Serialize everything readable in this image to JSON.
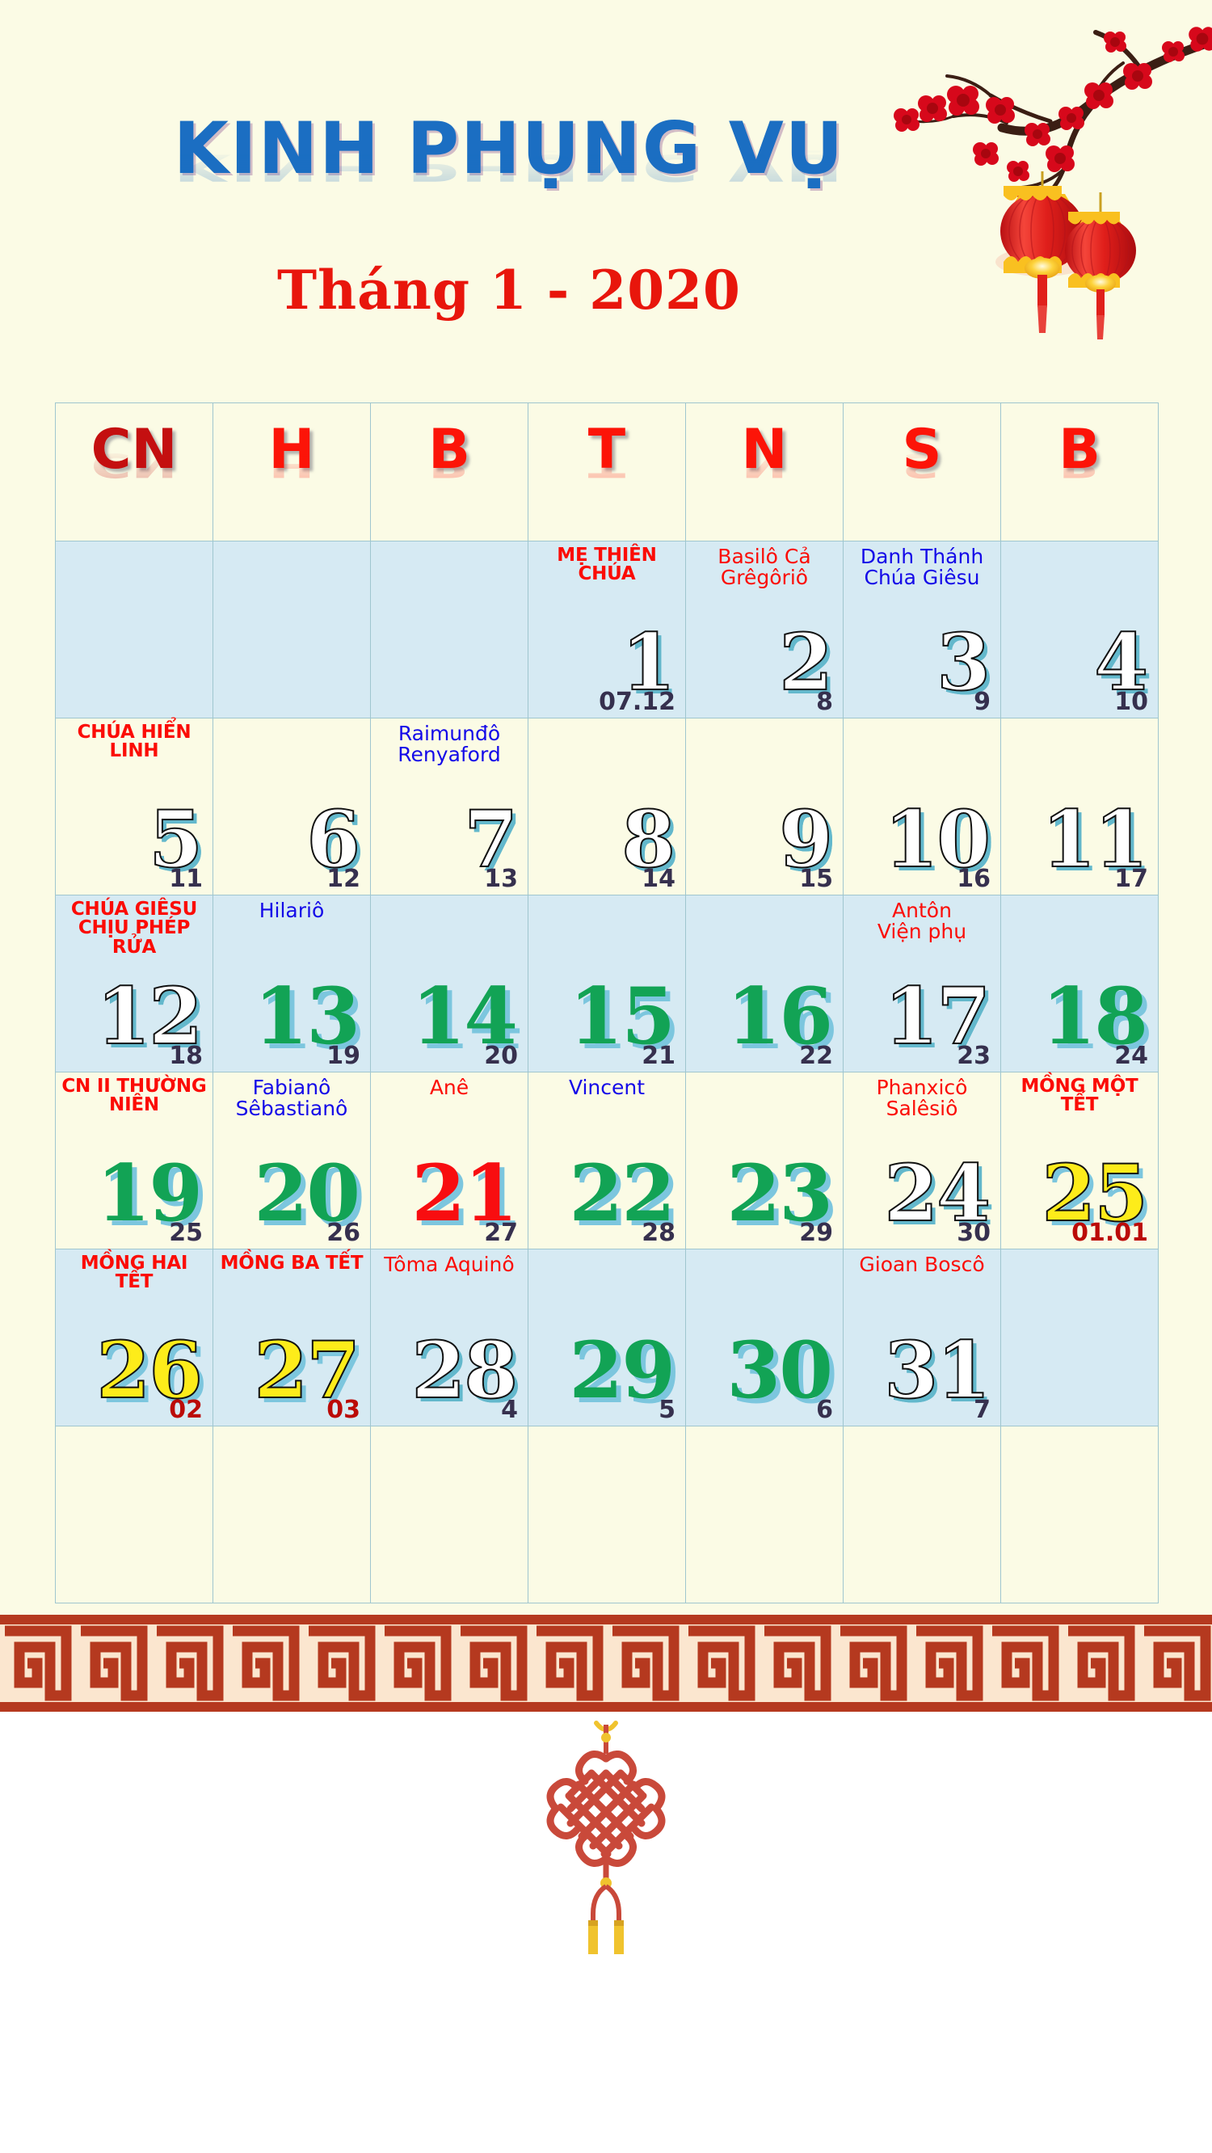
{
  "header": {
    "main_title": "KINH PHỤNG VỤ",
    "subtitle": "Tháng 1 - 2020",
    "title_color": "#1b6ec2",
    "subtitle_color": "#e8160c"
  },
  "decor": {
    "top_right": "plum-blossom-branch-and-lanterns-icon",
    "bottom": "chinese-knot-icon",
    "border_pattern": "greek-key-meander",
    "border_color": "#b5391f",
    "border_bg": "#fbe6cf",
    "lantern_color": "#e02019",
    "lantern_accent": "#f9c020",
    "blossom_color": "#d7081b",
    "branch_color": "#3b1e14",
    "knot_color": "#c9493a",
    "knot_tassel": "#f0c32e"
  },
  "weekdays": [
    {
      "label": "CN",
      "kind": "sun"
    },
    {
      "label": "H",
      "kind": "wk"
    },
    {
      "label": "B",
      "kind": "wk"
    },
    {
      "label": "T",
      "kind": "wk"
    },
    {
      "label": "N",
      "kind": "wk"
    },
    {
      "label": "S",
      "kind": "wk"
    },
    {
      "label": "B",
      "kind": "wk"
    }
  ],
  "colors": {
    "page_bg": "#fbfbe5",
    "row_blue": "#d6eaf3",
    "row_cream": "#fbfbe5",
    "grid_line": "#9fc6cf",
    "day_white": "#ffffff",
    "day_green": "#12a355",
    "day_red": "#f80d10",
    "day_yellow": "#fdec1a",
    "day_shadow": "#7cc6de",
    "lunar_text": "#36304e",
    "lunar_text_hl": "#bb0b08",
    "feast_red": "#fb0c06",
    "feast_blue": "#1409e8",
    "dow_sun": "#c40f10",
    "dow_week": "#fc1408"
  },
  "weeks": [
    {
      "bg": "blue",
      "days": [
        {
          "num": "",
          "feast": "",
          "feast_style": "",
          "lunar": "",
          "lunar_hl": false,
          "num_style": ""
        },
        {
          "num": "",
          "feast": "",
          "feast_style": "",
          "lunar": "",
          "lunar_hl": false,
          "num_style": ""
        },
        {
          "num": "",
          "feast": "",
          "feast_style": "",
          "lunar": "",
          "lunar_hl": false,
          "num_style": ""
        },
        {
          "num": "1",
          "feast": "MẸ THIÊN CHÚA",
          "feast_style": "solemn",
          "lunar": "07.12",
          "lunar_hl": false,
          "num_style": "white"
        },
        {
          "num": "2",
          "feast": "Basilô Cả\nGrêgôriô",
          "feast_style": "saint-red",
          "lunar": "8",
          "lunar_hl": false,
          "num_style": "white"
        },
        {
          "num": "3",
          "feast": "Danh Thánh\nChúa Giêsu",
          "feast_style": "saint-blue",
          "lunar": "9",
          "lunar_hl": false,
          "num_style": "white"
        },
        {
          "num": "4",
          "feast": "",
          "feast_style": "",
          "lunar": "10",
          "lunar_hl": false,
          "num_style": "white"
        }
      ]
    },
    {
      "bg": "cream",
      "days": [
        {
          "num": "5",
          "feast": "CHÚA HIỂN LINH",
          "feast_style": "solemn",
          "lunar": "11",
          "lunar_hl": false,
          "num_style": "white"
        },
        {
          "num": "6",
          "feast": "",
          "feast_style": "",
          "lunar": "12",
          "lunar_hl": false,
          "num_style": "white"
        },
        {
          "num": "7",
          "feast": "Raimunđô\nRenyaford",
          "feast_style": "saint-blue",
          "lunar": "13",
          "lunar_hl": false,
          "num_style": "white"
        },
        {
          "num": "8",
          "feast": "",
          "feast_style": "",
          "lunar": "14",
          "lunar_hl": false,
          "num_style": "white"
        },
        {
          "num": "9",
          "feast": "",
          "feast_style": "",
          "lunar": "15",
          "lunar_hl": false,
          "num_style": "white"
        },
        {
          "num": "10",
          "feast": "",
          "feast_style": "",
          "lunar": "16",
          "lunar_hl": false,
          "num_style": "white"
        },
        {
          "num": "11",
          "feast": "",
          "feast_style": "",
          "lunar": "17",
          "lunar_hl": false,
          "num_style": "white"
        }
      ]
    },
    {
      "bg": "blue",
      "days": [
        {
          "num": "12",
          "feast": "CHÚA GIÊSU\nCHỊU PHÉP RỬA",
          "feast_style": "solemn",
          "lunar": "18",
          "lunar_hl": false,
          "num_style": "white"
        },
        {
          "num": "13",
          "feast": "Hilariô",
          "feast_style": "saint-blue",
          "lunar": "19",
          "lunar_hl": false,
          "num_style": "green"
        },
        {
          "num": "14",
          "feast": "",
          "feast_style": "",
          "lunar": "20",
          "lunar_hl": false,
          "num_style": "green"
        },
        {
          "num": "15",
          "feast": "",
          "feast_style": "",
          "lunar": "21",
          "lunar_hl": false,
          "num_style": "green"
        },
        {
          "num": "16",
          "feast": "",
          "feast_style": "",
          "lunar": "22",
          "lunar_hl": false,
          "num_style": "green"
        },
        {
          "num": "17",
          "feast": "Antôn\nViện phụ",
          "feast_style": "saint-red",
          "lunar": "23",
          "lunar_hl": false,
          "num_style": "white"
        },
        {
          "num": "18",
          "feast": "",
          "feast_style": "",
          "lunar": "24",
          "lunar_hl": false,
          "num_style": "green"
        }
      ]
    },
    {
      "bg": "cream",
      "days": [
        {
          "num": "19",
          "feast": "CN II THƯỜNG NIÊN",
          "feast_style": "solemn",
          "lunar": "25",
          "lunar_hl": false,
          "num_style": "green"
        },
        {
          "num": "20",
          "feast": "Fabianô\nSêbastianô",
          "feast_style": "saint-blue",
          "lunar": "26",
          "lunar_hl": false,
          "num_style": "green"
        },
        {
          "num": "21",
          "feast": "Anê",
          "feast_style": "saint-red",
          "lunar": "27",
          "lunar_hl": false,
          "num_style": "red"
        },
        {
          "num": "22",
          "feast": "Vincent",
          "feast_style": "saint-blue",
          "lunar": "28",
          "lunar_hl": false,
          "num_style": "green"
        },
        {
          "num": "23",
          "feast": "",
          "feast_style": "",
          "lunar": "29",
          "lunar_hl": false,
          "num_style": "green"
        },
        {
          "num": "24",
          "feast": "Phanxicô\nSalêsiô",
          "feast_style": "saint-red",
          "lunar": "30",
          "lunar_hl": false,
          "num_style": "white"
        },
        {
          "num": "25",
          "feast": "MỒNG MỘT TẾT",
          "feast_style": "solemn",
          "lunar": "01.01",
          "lunar_hl": true,
          "num_style": "yellow"
        }
      ]
    },
    {
      "bg": "blue",
      "days": [
        {
          "num": "26",
          "feast": "MỒNG HAI TẾT",
          "feast_style": "solemn",
          "lunar": "02",
          "lunar_hl": true,
          "num_style": "yellow"
        },
        {
          "num": "27",
          "feast": "MỒNG BA TẾT",
          "feast_style": "solemn",
          "lunar": "03",
          "lunar_hl": true,
          "num_style": "yellow"
        },
        {
          "num": "28",
          "feast": "Tôma Aquinô",
          "feast_style": "saint-red",
          "lunar": "4",
          "lunar_hl": false,
          "num_style": "white"
        },
        {
          "num": "29",
          "feast": "",
          "feast_style": "",
          "lunar": "5",
          "lunar_hl": false,
          "num_style": "green"
        },
        {
          "num": "30",
          "feast": "",
          "feast_style": "",
          "lunar": "6",
          "lunar_hl": false,
          "num_style": "green"
        },
        {
          "num": "31",
          "feast": "Gioan Boscô",
          "feast_style": "saint-red",
          "lunar": "7",
          "lunar_hl": false,
          "num_style": "white"
        },
        {
          "num": "",
          "feast": "",
          "feast_style": "",
          "lunar": "",
          "lunar_hl": false,
          "num_style": ""
        }
      ]
    },
    {
      "bg": "cream",
      "days": [
        {
          "num": "",
          "feast": "",
          "feast_style": "",
          "lunar": "",
          "lunar_hl": false,
          "num_style": ""
        },
        {
          "num": "",
          "feast": "",
          "feast_style": "",
          "lunar": "",
          "lunar_hl": false,
          "num_style": ""
        },
        {
          "num": "",
          "feast": "",
          "feast_style": "",
          "lunar": "",
          "lunar_hl": false,
          "num_style": ""
        },
        {
          "num": "",
          "feast": "",
          "feast_style": "",
          "lunar": "",
          "lunar_hl": false,
          "num_style": ""
        },
        {
          "num": "",
          "feast": "",
          "feast_style": "",
          "lunar": "",
          "lunar_hl": false,
          "num_style": ""
        },
        {
          "num": "",
          "feast": "",
          "feast_style": "",
          "lunar": "",
          "lunar_hl": false,
          "num_style": ""
        },
        {
          "num": "",
          "feast": "",
          "feast_style": "",
          "lunar": "",
          "lunar_hl": false,
          "num_style": ""
        }
      ]
    }
  ]
}
